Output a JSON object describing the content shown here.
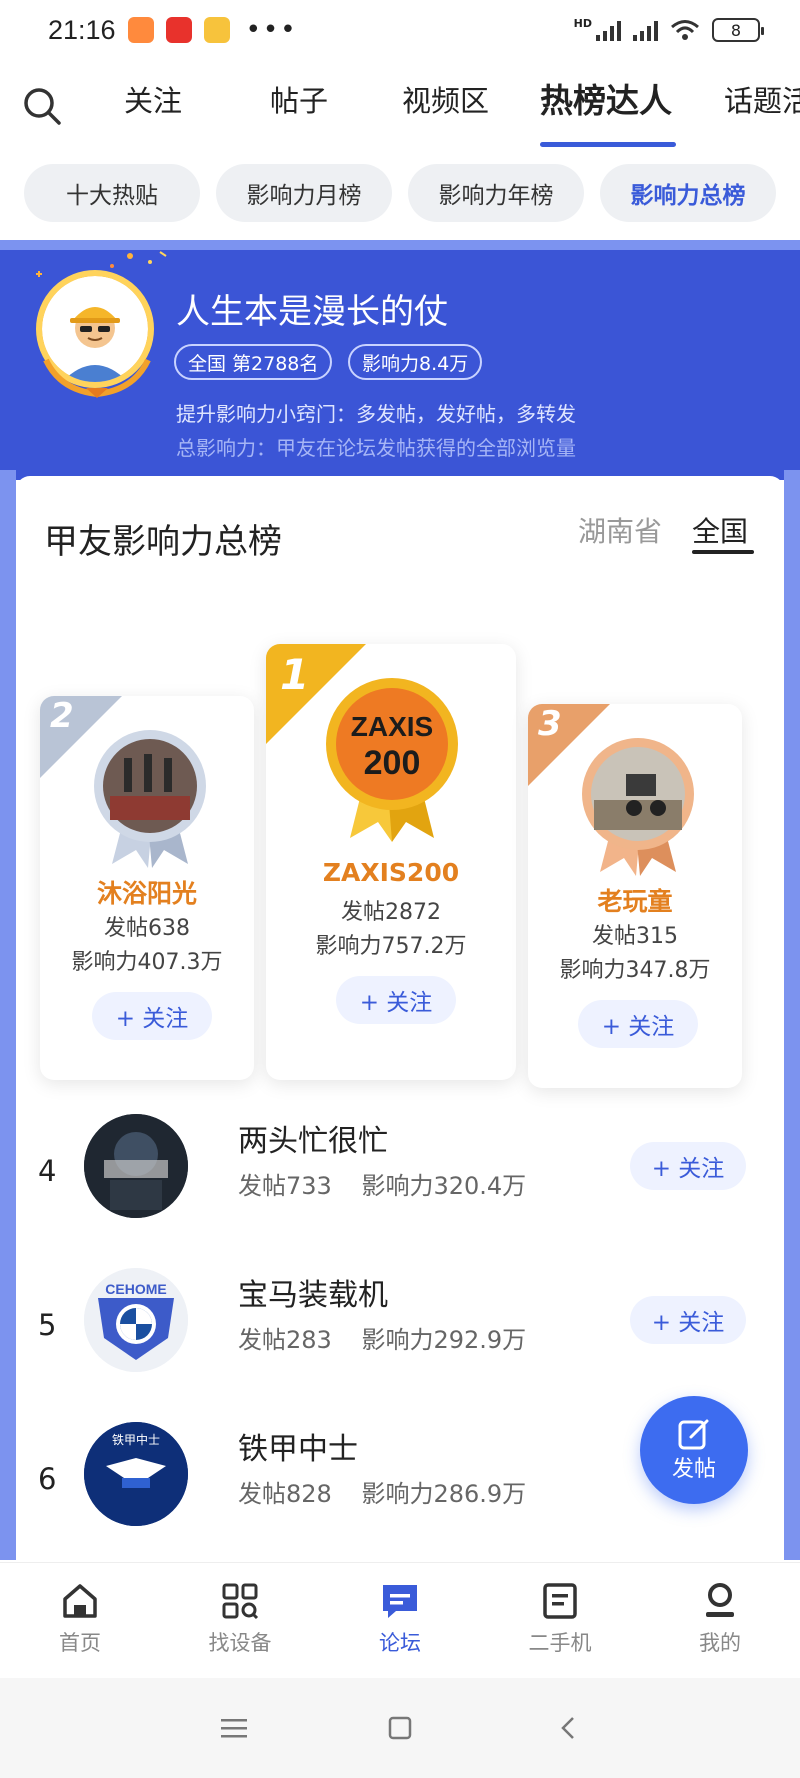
{
  "status_bar": {
    "time": "21:16",
    "dots": "•••",
    "battery": "8",
    "network": "HD"
  },
  "top_tabs": [
    "关注",
    "帖子",
    "视频区",
    "热榜达人",
    "话题活"
  ],
  "active_tab_index": 3,
  "chips": [
    "十大热贴",
    "影响力月榜",
    "影响力年榜",
    "影响力总榜"
  ],
  "active_chip_index": 3,
  "me": {
    "name": "人生本是漫长的仗",
    "rank_pill": "全国  第2788名",
    "influence_pill": "影响力8.4万",
    "tip": "提升影响力小窍门：多发帖，发好帖，多转发",
    "definition": "总影响力：甲友在论坛发帖获得的全部浏览量"
  },
  "board": {
    "title": "甲友影响力总榜",
    "region_province": "湖南省",
    "region_national": "全国",
    "active_region": "全国"
  },
  "podium": [
    {
      "rank": "2",
      "name": "沐浴阳光",
      "posts": "发帖638",
      "influence": "影响力407.3万",
      "follow": "+ 关注"
    },
    {
      "rank": "1",
      "name": "ZAXIS200",
      "posts": "发帖2872",
      "influence": "影响力757.2万",
      "follow": "+ 关注",
      "avatar_text_top": "ZAXIS",
      "avatar_text_bottom": "200"
    },
    {
      "rank": "3",
      "name": "老玩童",
      "posts": "发帖315",
      "influence": "影响力347.8万",
      "follow": "+ 关注"
    }
  ],
  "list": [
    {
      "rank": "4",
      "name": "两头忙很忙",
      "posts": "发帖733",
      "influence": "影响力320.4万",
      "follow": "+ 关注"
    },
    {
      "rank": "5",
      "name": "宝马装载机",
      "posts": "发帖283",
      "influence": "影响力292.9万",
      "follow": "+ 关注",
      "badge_text": "CEHOME"
    },
    {
      "rank": "6",
      "name": "铁甲中士",
      "posts": "发帖828",
      "influence": "影响力286.9万",
      "badge_text": "铁甲中士"
    }
  ],
  "fab_label": "发帖",
  "bottom_nav": [
    "首页",
    "找设备",
    "论坛",
    "二手机",
    "我的"
  ],
  "active_bottom_index": 2,
  "colors": {
    "brand_blue": "#3b55d6",
    "accent_blue": "#3a5bd9",
    "gold": "#f2b520",
    "silver": "#b9c4d6",
    "bronze": "#e8a06a",
    "name_orange": "#e3801f"
  }
}
